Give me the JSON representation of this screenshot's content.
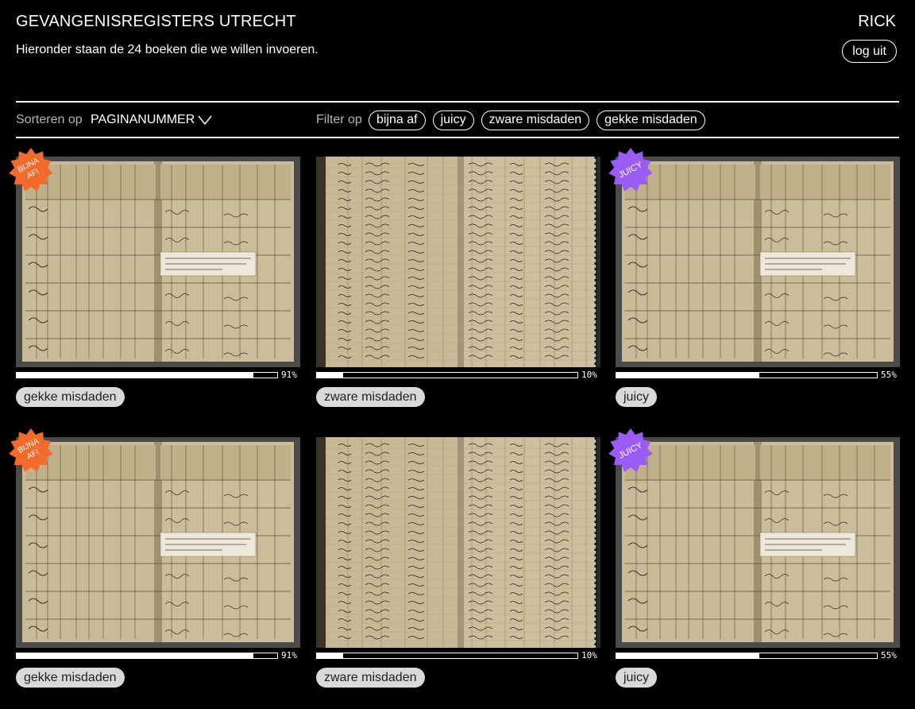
{
  "header": {
    "title": "GEVANGENISREGISTERS UTRECHT",
    "subtitle": "Hieronder staan de 24 boeken die we willen invoeren.",
    "user": "RICK",
    "logout_label": "log uit"
  },
  "toolbar": {
    "sort_label": "Sorteren op",
    "sort_value": "PAGINANUMMER",
    "filter_label": "Filter op",
    "filters": [
      "bijna af",
      "juicy",
      "zware misdaden",
      "gekke misdaden"
    ]
  },
  "colors": {
    "badge_bijna_af": "#f26b2a",
    "badge_juicy": "#9b5cf6",
    "chip_bg": "#d9d9d9",
    "page_bg": "#000000"
  },
  "books": [
    {
      "progress": 0.91,
      "progress_label": "91%",
      "tag": "gekke misdaden",
      "badge": "BIJNA AF!",
      "badge_type": "bijna_af",
      "scan": "ledger-form"
    },
    {
      "progress": 0.1,
      "progress_label": "10%",
      "tag": "zware misdaden",
      "badge": null,
      "badge_type": null,
      "scan": "ledger-handwritten"
    },
    {
      "progress": 0.55,
      "progress_label": "55%",
      "tag": "juicy",
      "badge": "JUICY",
      "badge_type": "juicy",
      "scan": "ledger-form"
    },
    {
      "progress": 0.91,
      "progress_label": "91%",
      "tag": "gekke misdaden",
      "badge": "BIJNA AF!",
      "badge_type": "bijna_af",
      "scan": "ledger-form"
    },
    {
      "progress": 0.1,
      "progress_label": "10%",
      "tag": "zware misdaden",
      "badge": null,
      "badge_type": null,
      "scan": "ledger-handwritten"
    },
    {
      "progress": 0.55,
      "progress_label": "55%",
      "tag": "juicy",
      "badge": "JUICY",
      "badge_type": "juicy",
      "scan": "ledger-form"
    }
  ]
}
